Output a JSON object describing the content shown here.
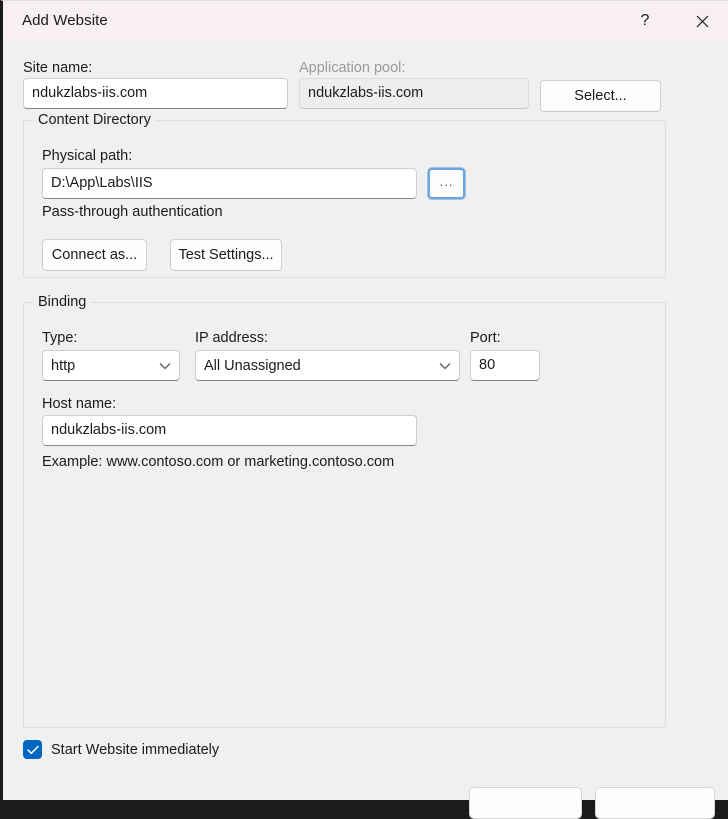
{
  "window": {
    "title": "Add Website",
    "help_icon": "question-mark-icon",
    "close_icon": "close-icon"
  },
  "form": {
    "site_name_label": "Site name:",
    "site_name_value": "ndukzlabs-iis.com",
    "app_pool_label": "Application pool:",
    "app_pool_value": "ndukzlabs-iis.com",
    "select_button": "Select..."
  },
  "content_directory": {
    "group_title": "Content Directory",
    "physical_path_label": "Physical path:",
    "physical_path_value": "D:\\App\\Labs\\IIS",
    "browse_button": "...",
    "auth_text": "Pass-through authentication",
    "connect_as_button": "Connect as...",
    "test_settings_button": "Test Settings..."
  },
  "binding": {
    "group_title": "Binding",
    "type_label": "Type:",
    "type_value": "http",
    "ip_label": "IP address:",
    "ip_value": "All Unassigned",
    "port_label": "Port:",
    "port_value": "80",
    "host_label": "Host name:",
    "host_value": "ndukzlabs-iis.com",
    "example_text": "Example: www.contoso.com or marketing.contoso.com"
  },
  "footer": {
    "start_immediately_label": "Start Website immediately",
    "start_immediately_checked": true,
    "ok_button": "",
    "cancel_button": ""
  },
  "colors": {
    "titlebar": "#f7eff1",
    "body": "#f0f0f0",
    "accent": "#0067c0",
    "focus_ring": "#6ba6de"
  }
}
